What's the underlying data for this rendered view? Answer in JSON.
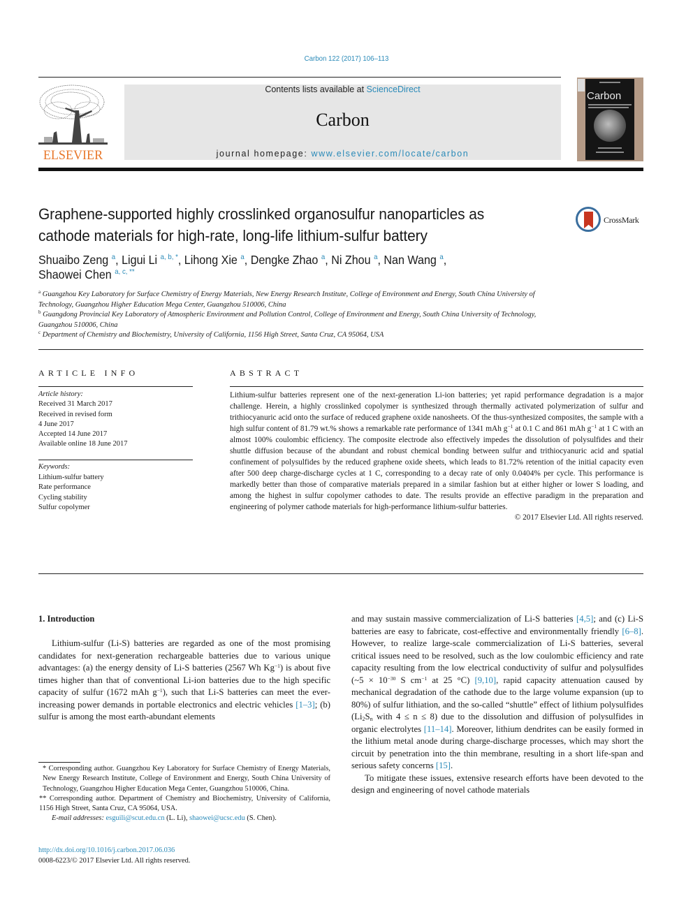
{
  "citation": "Carbon 122 (2017) 106–113",
  "masthead": {
    "contents_prefix": "Contents lists available at ",
    "contents_link": "ScienceDirect",
    "journal_name": "Carbon",
    "homepage_prefix": "journal homepage: ",
    "homepage_link": "www.elsevier.com/locate/carbon",
    "publisher_logo_text": "ELSEVIER",
    "cover_title": "Carbon",
    "colors": {
      "link": "#2a8ab8",
      "publisher_orange": "#e8772a",
      "masthead_bg": "#e6e6e6",
      "cover_frame": "#b49a86"
    }
  },
  "article": {
    "title": "Graphene-supported highly crosslinked organosulfur nanoparticles as cathode materials for high-rate, long-life lithium-sulfur battery",
    "crossmark_label": "CrossMark",
    "authors": [
      {
        "name": "Shuaibo Zeng",
        "marks": "a",
        "sep": ", "
      },
      {
        "name": "Ligui Li",
        "marks": "a, b, *",
        "sep": ", "
      },
      {
        "name": "Lihong Xie",
        "marks": "a",
        "sep": ", "
      },
      {
        "name": "Dengke Zhao",
        "marks": "a",
        "sep": ", "
      },
      {
        "name": "Ni Zhou",
        "marks": "a",
        "sep": ", "
      },
      {
        "name": "Nan Wang",
        "marks": "a",
        "sep": ", "
      },
      {
        "name": "Shaowei Chen",
        "marks": "a, c, **",
        "sep": ""
      }
    ],
    "affiliations": [
      {
        "mark": "a",
        "text": "Guangzhou Key Laboratory for Surface Chemistry of Energy Materials, New Energy Research Institute, College of Environment and Energy, South China University of Technology, Guangzhou Higher Education Mega Center, Guangzhou 510006, China"
      },
      {
        "mark": "b",
        "text": "Guangdong Provincial Key Laboratory of Atmospheric Environment and Pollution Control, College of Environment and Energy, South China University of Technology, Guangzhou 510006, China"
      },
      {
        "mark": "c",
        "text": "Department of Chemistry and Biochemistry, University of California, 1156 High Street, Santa Cruz, CA 95064, USA"
      }
    ]
  },
  "article_info": {
    "heading": "ARTICLE INFO",
    "history_label": "Article history:",
    "history": [
      "Received 31 March 2017",
      "Received in revised form",
      "4 June 2017",
      "Accepted 14 June 2017",
      "Available online 18 June 2017"
    ],
    "keywords_label": "Keywords:",
    "keywords": [
      "Lithium-sulfur battery",
      "Rate performance",
      "Cycling stability",
      "Sulfur copolymer"
    ]
  },
  "abstract": {
    "heading": "ABSTRACT",
    "part1": "Lithium-sulfur batteries represent one of the next-generation Li-ion batteries; yet rapid performance degradation is a major challenge. Herein, a highly crosslinked copolymer is synthesized through thermally activated polymerization of sulfur and trithiocyanuric acid onto the surface of reduced graphene oxide nanosheets. Of the thus-synthesized composites, the sample with a high sulfur content of 81.79 wt.% shows a remarkable rate performance of 1341 mAh g",
    "sup1": "−1",
    "part2": " at 0.1 C and 861 mAh g",
    "sup2": "−1",
    "part3": " at 1 C with an almost 100% coulombic efficiency. The composite electrode also effectively impedes the dissolution of polysulfides and their shuttle diffusion because of the abundant and robust chemical bonding between sulfur and trithiocyanuric acid and spatial confinement of polysulfides by the reduced graphene oxide sheets, which leads to 81.72% retention of the initial capacity even after 500 deep charge-discharge cycles at 1 C, corresponding to a decay rate of only 0.0404% per cycle. This performance is markedly better than those of comparative materials prepared in a similar fashion but at either higher or lower S loading, and among the highest in sulfur copolymer cathodes to date. The results provide an effective paradigm in the preparation and engineering of polymer cathode materials for high-performance lithium-sulfur batteries.",
    "copyright": "© 2017 Elsevier Ltd. All rights reserved."
  },
  "introduction": {
    "heading": "1.  Introduction",
    "left": {
      "t1": "Lithium-sulfur (Li-S) batteries are regarded as one of the most promising candidates for next-generation rechargeable batteries due to various unique advantages: (a) the energy density of Li-S batteries (2567 Wh Kg",
      "s1": "−1",
      "t2": ") is about five times higher than that of conventional Li-ion batteries due to the high specific capacity of sulfur (1672 mAh g",
      "s2": "−1",
      "t3": "), such that Li-S batteries can meet the ever-increasing power demands in portable electronics and electric vehicles ",
      "ref1": "[1–3]",
      "t4": "; (b) sulfur is among the most earth-abundant elements"
    },
    "right": {
      "t1": "and may sustain massive commercialization of Li-S batteries ",
      "ref1": "[4,5]",
      "t2": "; and (c) Li-S batteries are easy to fabricate, cost-effective and environmentally friendly ",
      "ref2": "[6–8]",
      "t3": ". However, to realize large-scale commercialization of Li-S batteries, several critical issues need to be resolved, such as the low coulombic efficiency and rate capacity resulting from the low electrical conductivity of sulfur and polysulfides (~5 × 10",
      "s1": "−30",
      "t4": " S cm",
      "s2": "−1",
      "t5": " at 25 °C) ",
      "ref3": "[9,10]",
      "t6": ", rapid capacity attenuation caused by mechanical degradation of the cathode due to the large volume expansion (up to 80%) of sulfur lithiation, and the so-called “shuttle” effect of lithium polysulfides (Li",
      "sub1": "2",
      "t7": "S",
      "sub2": "n",
      "t8": " with 4 ≤ n ≤ 8) due to the dissolution and diffusion of polysulfides in organic electrolytes ",
      "ref4": "[11–14]",
      "t9": ". Moreover, lithium dendrites can be easily formed in the lithium metal anode during charge-discharge processes, which may short the circuit by penetration into the thin membrane, resulting in a short life-span and serious safety concerns ",
      "ref5": "[15]",
      "t10": ".",
      "p2": "To mitigate these issues, extensive research efforts have been devoted to the design and engineering of novel cathode materials"
    }
  },
  "footnotes": {
    "fn1": "* Corresponding author. Guangzhou Key Laboratory for Surface Chemistry of Energy Materials, New Energy Research Institute, College of Environment and Energy, South China University of Technology, Guangzhou Higher Education Mega Center, Guangzhou 510006, China.",
    "fn2": "** Corresponding author. Department of Chemistry and Biochemistry, University of California, 1156 High Street, Santa Cruz, CA 95064, USA.",
    "email_label": "E-mail addresses:",
    "email1": "esguili@scut.edu.cn",
    "email1_owner": " (L. Li), ",
    "email2": "shaowei@ucsc.edu",
    "email2_owner": " (S. Chen)."
  },
  "doi": {
    "link": "http://dx.doi.org/10.1016/j.carbon.2017.06.036",
    "issn_line": "0008-6223/© 2017 Elsevier Ltd. All rights reserved."
  }
}
